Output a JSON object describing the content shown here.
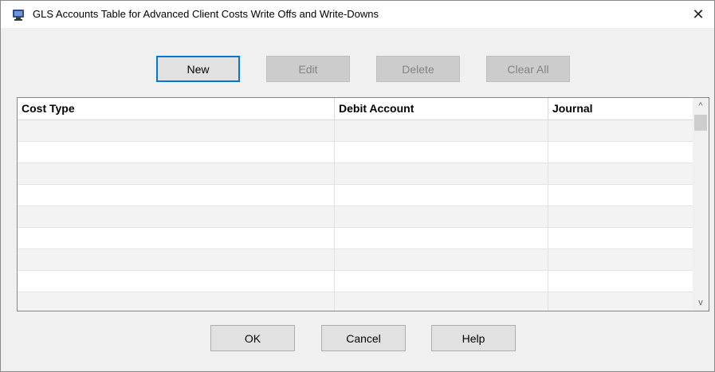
{
  "window": {
    "title": "GLS Accounts Table for Advanced Client Costs Write Offs and Write-Downs",
    "close_glyph": "✕"
  },
  "toolbar": {
    "new_label": "New",
    "edit_label": "Edit",
    "delete_label": "Delete",
    "clear_all_label": "Clear All"
  },
  "table": {
    "columns": [
      "Cost Type",
      "Debit Account",
      "Journal"
    ],
    "rows": [
      [
        "",
        "",
        ""
      ],
      [
        "",
        "",
        ""
      ],
      [
        "",
        "",
        ""
      ],
      [
        "",
        "",
        ""
      ],
      [
        "",
        "",
        ""
      ],
      [
        "",
        "",
        ""
      ],
      [
        "",
        "",
        ""
      ],
      [
        "",
        "",
        ""
      ],
      [
        "",
        "",
        ""
      ]
    ]
  },
  "scrollbar": {
    "up_glyph": "^",
    "down_glyph": "v"
  },
  "footer": {
    "ok_label": "OK",
    "cancel_label": "Cancel",
    "help_label": "Help"
  },
  "colors": {
    "accent": "#0078d7",
    "disabled_bg": "#cccccc",
    "alt_row": "#f3f3f3"
  }
}
